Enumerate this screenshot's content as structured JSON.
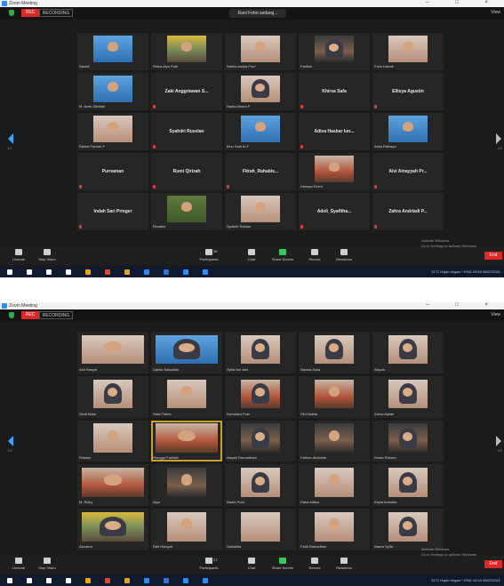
{
  "screens": [
    {
      "title": "Zoom Meeting",
      "recording_label": "REC",
      "recording_status": "RECORDING",
      "notice": "Rani Febri sedang...",
      "view_label": "View",
      "page_left": "1/2",
      "page_right": "1/2",
      "tiles": [
        {
          "caption": "Naufal",
          "type": "photo",
          "tone": "blue"
        },
        {
          "caption": "Raisa Alya Putri",
          "type": "photo",
          "tone": "yellow"
        },
        {
          "caption": "Nabila Auliya Putri",
          "type": "photo",
          "tone": "soft"
        },
        {
          "caption": "Fadilah",
          "type": "photo",
          "tone": "dark",
          "hijab": true
        },
        {
          "caption": "Faris Hanafi",
          "type": "photo",
          "tone": "soft"
        },
        {
          "caption": "M. Azmi Zikrillah",
          "type": "photo",
          "tone": "blue"
        },
        {
          "name": "Zaki Anggriawan S...",
          "type": "name"
        },
        {
          "caption": "Nadia Almira P",
          "type": "photo",
          "tone": "soft",
          "hijab": true
        },
        {
          "name": "Khirsa Safa",
          "type": "name"
        },
        {
          "name": "Ellisya Agustin",
          "type": "name"
        },
        {
          "caption": "Rafael Farhan P",
          "type": "photo",
          "tone": "soft"
        },
        {
          "name": "Syahdri Ruselan",
          "type": "name"
        },
        {
          "caption": "Ibnu Said Al-F",
          "type": "photo",
          "tone": "blue"
        },
        {
          "name": "Adiva Hasbar Iun...",
          "type": "name"
        },
        {
          "caption": "Azka Rafasya",
          "type": "photo",
          "tone": "blue"
        },
        {
          "name": "Purnaman",
          "type": "name"
        },
        {
          "name": "Rumi Qirizah",
          "type": "name"
        },
        {
          "name": "Fitrah_Rahabis...",
          "type": "name"
        },
        {
          "caption": "Kanaya Elvira",
          "type": "photo",
          "tone": "warm"
        },
        {
          "name": "Alvi Ainayyah Pr...",
          "type": "name"
        },
        {
          "name": "Indah Sari Pringer",
          "type": "name"
        },
        {
          "caption": "Rosallul",
          "type": "photo",
          "tone": "green"
        },
        {
          "caption": "Syakhir Raihan",
          "type": "photo",
          "tone": "soft"
        },
        {
          "name": "Adeli_Syafitha...",
          "type": "name"
        },
        {
          "name": "Zahra Andriadi P...",
          "type": "name"
        }
      ],
      "toolbar": [
        {
          "label": "Unmute",
          "icon": "microphone-icon"
        },
        {
          "label": "Stop Video",
          "icon": "camera-icon"
        },
        {
          "label": "Participants",
          "icon": "participants-icon",
          "count": "26"
        },
        {
          "label": "Chat",
          "icon": "chat-icon"
        },
        {
          "label": "Share Screen",
          "icon": "share-screen-icon"
        },
        {
          "label": "Record",
          "icon": "record-icon"
        },
        {
          "label": "Reactions",
          "icon": "reactions-icon"
        }
      ],
      "end_label": "End",
      "watermark_line1": "Activate Windows",
      "watermark_line2": "Go to Settings to activate Windows.",
      "tray_text": "31°C Hujan ringan  ^  ENG  09.54 09/07/2021"
    },
    {
      "title": "Zoom Meeting",
      "recording_label": "REC",
      "recording_status": "RECORDING",
      "view_label": "View",
      "page_left": "1/2",
      "page_right": "1/2",
      "tiles": [
        {
          "caption": "Aldi Rasyid",
          "type": "photo",
          "tone": "soft",
          "wide": true
        },
        {
          "caption": "Dahlia Salsabila",
          "type": "photo",
          "tone": "blue",
          "wide": true,
          "hijab": true
        },
        {
          "caption": "Syifa Nur Aini",
          "type": "photo",
          "tone": "soft",
          "hijab": true
        },
        {
          "caption": "Nazwa Aulia",
          "type": "photo",
          "tone": "soft",
          "hijab": true
        },
        {
          "caption": "Aisyah",
          "type": "photo",
          "tone": "soft",
          "hijab": true
        },
        {
          "caption": "Sindi Mala",
          "type": "photo",
          "tone": "soft",
          "hijab": true
        },
        {
          "caption": "Rafa Fidela",
          "type": "photo",
          "tone": "soft"
        },
        {
          "caption": "Nurhaliza Putri",
          "type": "photo",
          "tone": "warm",
          "hijab": true
        },
        {
          "caption": "Fitri Nabila",
          "type": "photo",
          "tone": "warm"
        },
        {
          "caption": "Zahra Aqilah",
          "type": "photo",
          "tone": "soft",
          "hijab": true
        },
        {
          "caption": "Ridwan",
          "type": "photo",
          "tone": "soft"
        },
        {
          "caption": "Rangga Fadillah",
          "type": "photo",
          "tone": "warm",
          "wide": true,
          "active": true
        },
        {
          "caption": "Aisyah Ramadhani",
          "type": "photo",
          "tone": "dark",
          "hijab": true
        },
        {
          "caption": "Farhan Abdullah",
          "type": "photo",
          "tone": "dark"
        },
        {
          "caption": "Dinda Rahma",
          "type": "photo",
          "tone": "dark",
          "hijab": true
        },
        {
          "caption": "M. Rizky",
          "type": "photo",
          "tone": "warm",
          "wide": true
        },
        {
          "caption": "Alya",
          "type": "photo",
          "tone": "dark"
        },
        {
          "caption": "Nadia Putri",
          "type": "photo",
          "tone": "soft",
          "hijab": true
        },
        {
          "caption": "Raka Aditya",
          "type": "photo",
          "tone": "soft"
        },
        {
          "caption": "Keyla Anindita",
          "type": "photo",
          "tone": "soft",
          "hijab": true
        },
        {
          "caption": "Azzahra",
          "type": "photo",
          "tone": "yellow",
          "wide": true,
          "hijab": true
        },
        {
          "caption": "Rafi Hidayat",
          "type": "photo",
          "tone": "soft"
        },
        {
          "caption": "Salsabila",
          "type": "photo",
          "tone": "soft",
          "blank": true
        },
        {
          "caption": "Fadil Ramadhan",
          "type": "photo",
          "tone": "soft"
        },
        {
          "caption": "Naura Syifa",
          "type": "photo",
          "tone": "soft",
          "hijab": true
        }
      ],
      "toolbar": [
        {
          "label": "Unmute",
          "icon": "microphone-icon"
        },
        {
          "label": "Stop Video",
          "icon": "camera-icon"
        },
        {
          "label": "Participants",
          "icon": "participants-icon",
          "count": "27"
        },
        {
          "label": "Chat",
          "icon": "chat-icon"
        },
        {
          "label": "Share Screen",
          "icon": "share-screen-icon"
        },
        {
          "label": "Record",
          "icon": "record-icon"
        },
        {
          "label": "Reactions",
          "icon": "reactions-icon"
        }
      ],
      "end_label": "End",
      "watermark_line1": "Activate Windows",
      "watermark_line2": "Go to Settings to activate Windows.",
      "tray_text": "31°C Hujan ringan  ^  ENG  10.04 09/07/2021"
    }
  ],
  "colors": {
    "background": "#1b1b1b",
    "record": "#e02828",
    "share": "#34c759",
    "accent": "#2d8cff",
    "active_speaker": "#c9a227"
  }
}
